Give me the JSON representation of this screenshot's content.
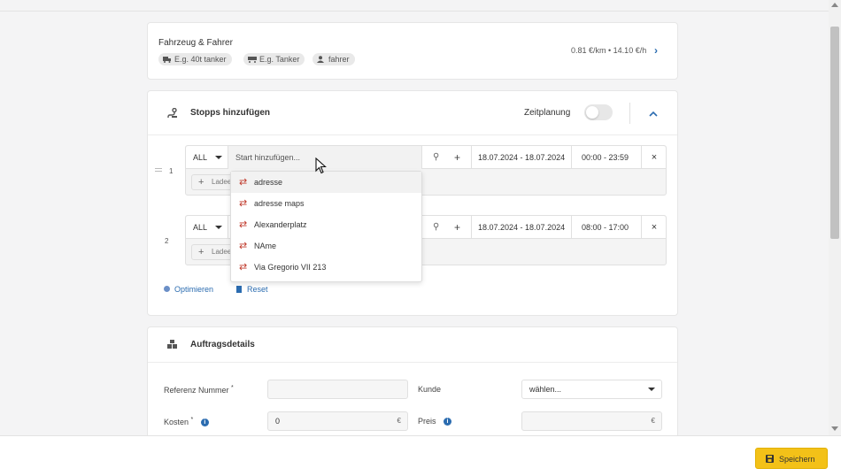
{
  "vehicle_card": {
    "title": "Fahrzeug & Fahrer",
    "tags": [
      "E.g. 40t tanker",
      "E.g. Tanker",
      "fahrer"
    ],
    "rate": "0.81 €/km • 14.10 €/h"
  },
  "stops_card": {
    "title": "Stopps hinzufügen",
    "scheduling_label": "Zeitplanung",
    "stops": [
      {
        "index": "1",
        "type": "ALL",
        "placeholder": "Start hinzufügen...",
        "date_range": "18.07.2024 - 18.07.2024",
        "time_range": "00:00 - 23:59",
        "add_label": "Ladee"
      },
      {
        "index": "2",
        "type": "ALL",
        "date_range": "18.07.2024 - 18.07.2024",
        "time_range": "08:00 - 17:00",
        "add_label": "Ladee"
      }
    ],
    "dropdown": [
      "adresse",
      "adresse maps",
      "Alexanderplatz",
      "NAme",
      "Via Gregorio VII 213"
    ],
    "optimize_label": "Optimieren",
    "reset_label": "Reset"
  },
  "order_card": {
    "title": "Auftragsdetails",
    "reference_label": "Referenz Nummer",
    "customer_label": "Kunde",
    "customer_value": "wählen...",
    "costs_label": "Kosten",
    "costs_value": "0",
    "currency": "€",
    "price_label": "Preis",
    "required_mark": "*"
  },
  "footer": {
    "save_label": "Speichern"
  },
  "colors": {
    "accent": "#f3c118",
    "link": "#2b6cb0",
    "route_icon": "#c0392b"
  }
}
